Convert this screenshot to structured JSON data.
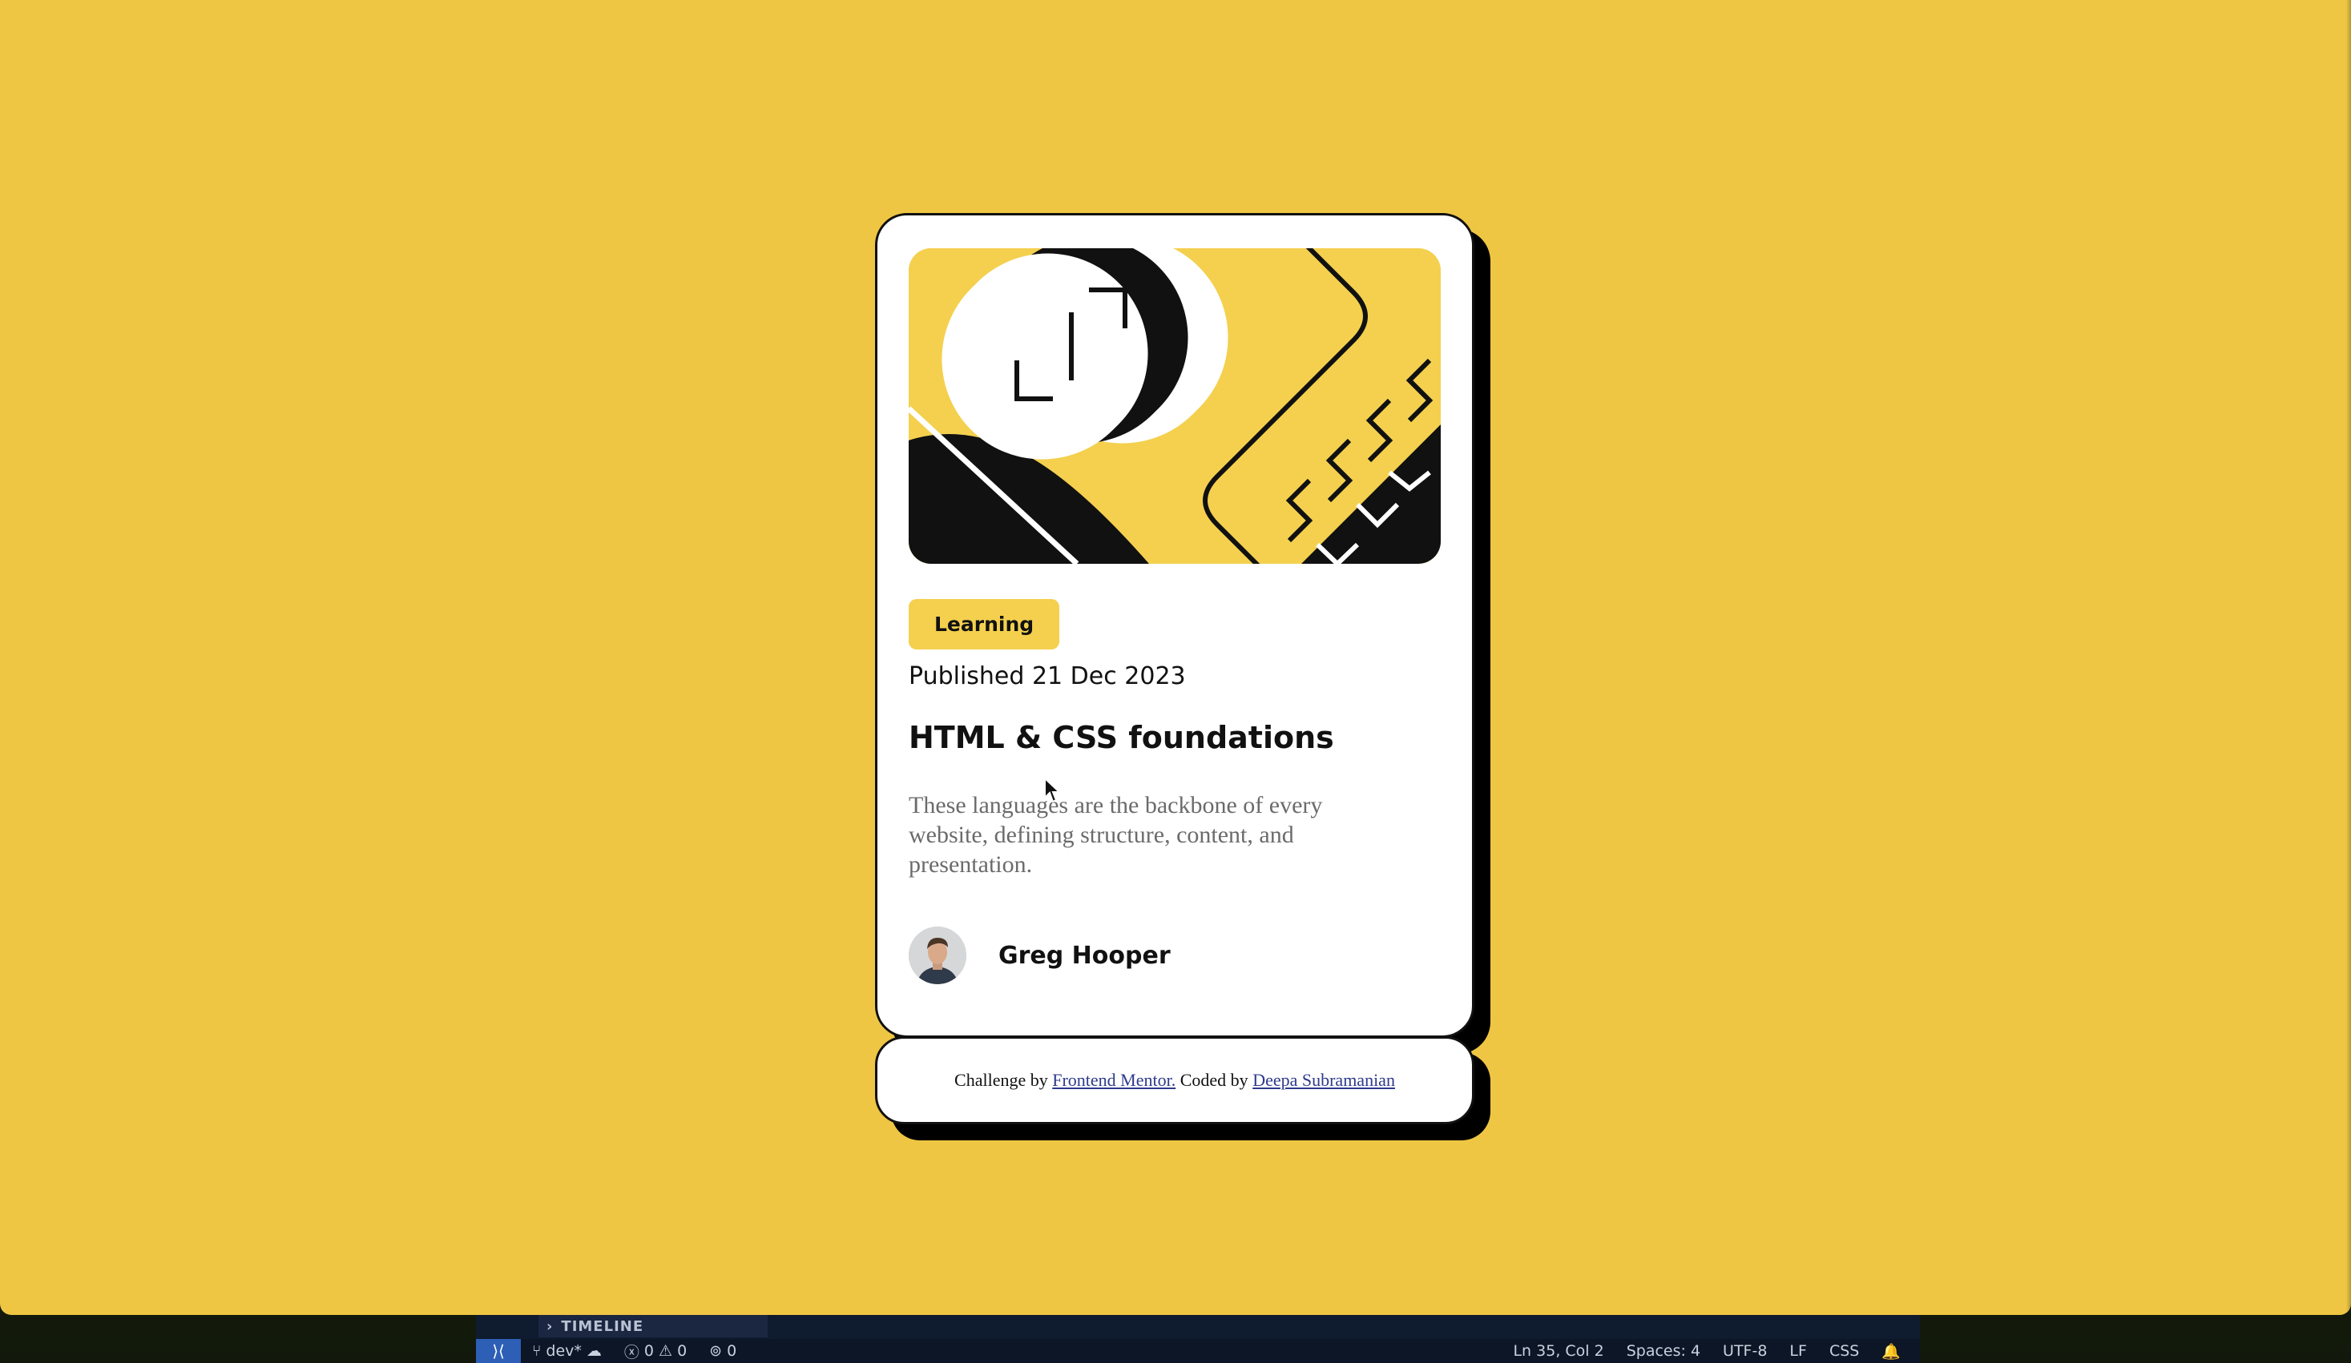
{
  "card": {
    "tag": "Learning",
    "published": "Published 21 Dec 2023",
    "title": "HTML & CSS foundations",
    "description": "These languages are the backbone of every website, defining structure, content, and presentation.",
    "author": "Greg Hooper"
  },
  "footer": {
    "prefix": "Challenge by ",
    "link1": "Frontend Mentor.",
    "middle": " Coded by ",
    "link2": "Deepa Subramanian"
  },
  "editor": {
    "panel_title": "TIMELINE",
    "branch": "dev*",
    "errors": "0",
    "warnings": "0",
    "ports": "0",
    "cursor_pos": "Ln 35, Col 2",
    "spaces": "Spaces: 4",
    "encoding": "UTF-8",
    "eol": "LF",
    "language": "CSS"
  },
  "colors": {
    "page_bg": "#efc643",
    "accent_yellow": "#f4d04e",
    "ink": "#111111",
    "muted_text": "#6b6b6b",
    "link": "#2e3a8c",
    "statusbar_bg": "#0d1626",
    "remote_bg": "#2d5fb6"
  }
}
